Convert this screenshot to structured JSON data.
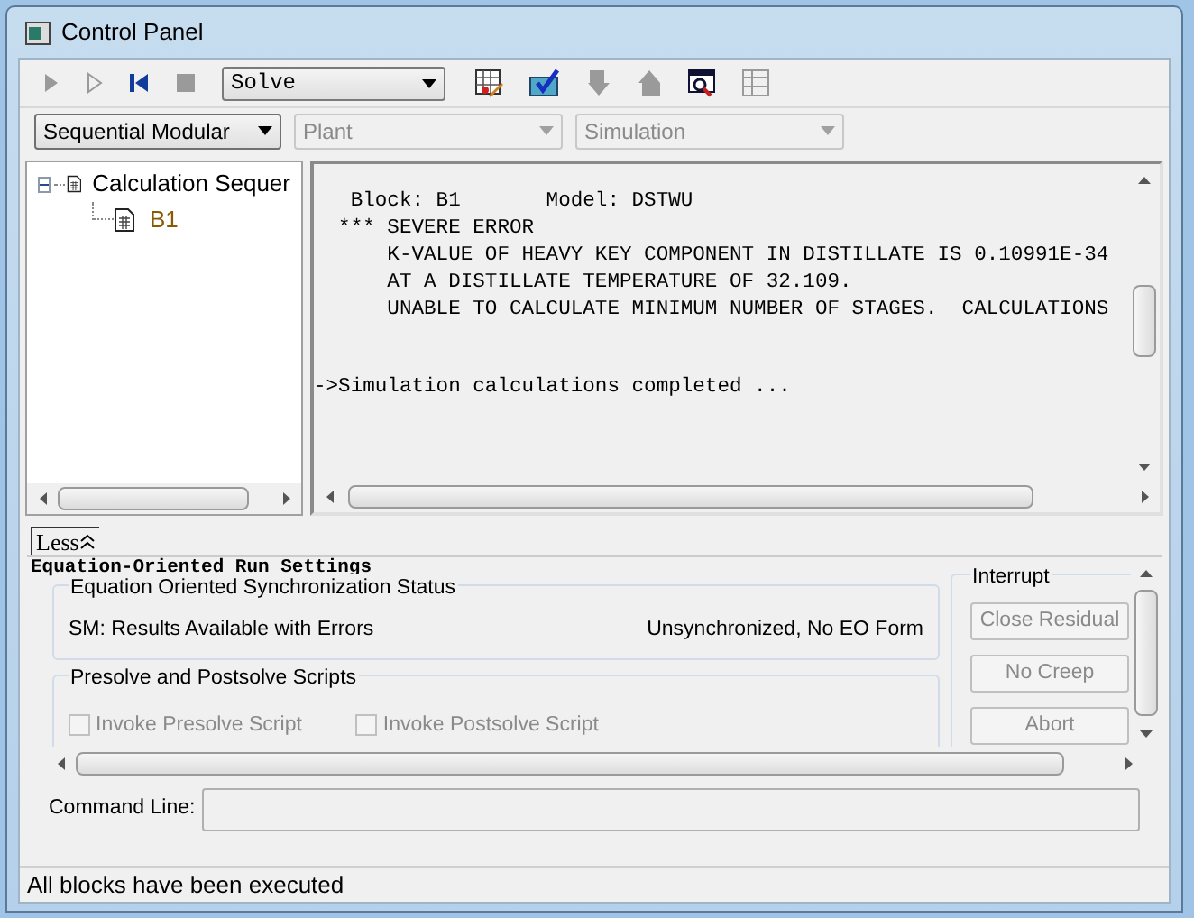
{
  "window": {
    "title": "Control Panel"
  },
  "toolbar": [
    {
      "kind": "run",
      "disabled": true
    },
    {
      "kind": "step",
      "disabled": true
    },
    {
      "kind": "reset",
      "disabled": false
    },
    {
      "kind": "stop",
      "disabled": true
    },
    {
      "kind": "dropdown",
      "value": "Solve",
      "disabled": false
    },
    {
      "kind": "check-grid",
      "disabled": false
    },
    {
      "kind": "check-folder",
      "disabled": false
    },
    {
      "kind": "move-down",
      "disabled": true
    },
    {
      "kind": "move-up",
      "disabled": true
    },
    {
      "kind": "inspect",
      "disabled": false
    },
    {
      "kind": "table",
      "disabled": true
    }
  ],
  "selectors": [
    {
      "value": "Sequential Modular",
      "disabled": false
    },
    {
      "value": "Plant",
      "disabled": true
    },
    {
      "value": "Simulation",
      "disabled": true
    }
  ],
  "tree": [
    {
      "label": "Calculation Sequer",
      "expanded": true,
      "children": [
        {
          "label": "B1"
        }
      ]
    }
  ],
  "log": [
    [
      "   Block: B1       Model: DSTWU",
      "  *** SEVERE ERROR",
      "      K-VALUE OF HEAVY KEY COMPONENT IN DISTILLATE IS 0.10991E-34",
      "      AT A DISTILLATE TEMPERATURE OF 32.109.",
      "      UNABLE TO CALCULATE MINIMUM NUMBER OF STAGES.  CALCULATIONS"
    ],
    [
      "->Simulation calculations completed ..."
    ]
  ],
  "toggle": {
    "label": "Less",
    "expanded": true
  },
  "eo_settings": {
    "title": "Equation-Oriented Run Settings",
    "sync": {
      "title": "Equation Oriented Synchronization Status",
      "status": "SM: Results Available with Errors",
      "form": "Unsynchronized, No EO Form"
    },
    "scripts": {
      "title": "Presolve and Postsolve Scripts",
      "options": [
        {
          "label": "Invoke Presolve Script",
          "checked": false,
          "disabled": true
        },
        {
          "label": "Invoke Postsolve Script",
          "checked": false,
          "disabled": true
        }
      ]
    },
    "interrupt": {
      "title": "Interrupt",
      "buttons": [
        {
          "label": "Close Residual",
          "disabled": true
        },
        {
          "label": "No Creep",
          "disabled": true
        },
        {
          "label": "Abort",
          "disabled": true
        }
      ]
    }
  },
  "command_line": {
    "label": "Command Line:"
  },
  "status_bar": "All blocks have been executed"
}
